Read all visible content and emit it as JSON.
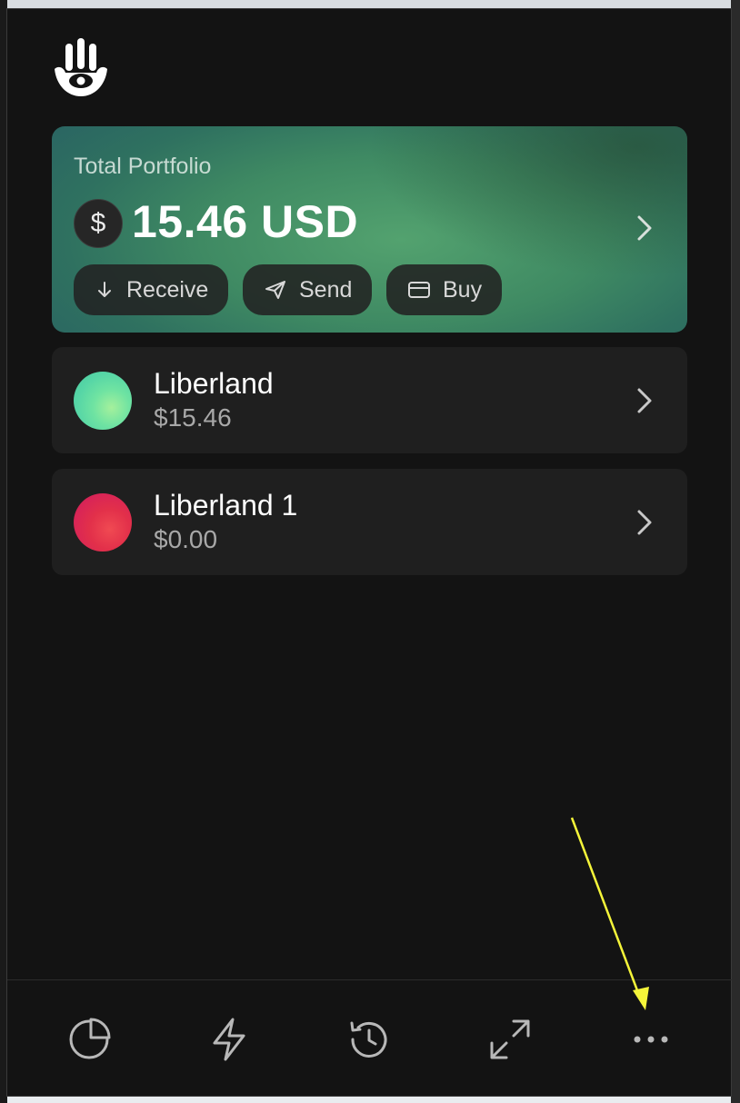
{
  "portfolio": {
    "label": "Total Portfolio",
    "currency_symbol": "$",
    "amount": "15.46 USD"
  },
  "actions": {
    "receive_label": "Receive",
    "send_label": "Send",
    "buy_label": "Buy"
  },
  "accounts": [
    {
      "name": "Liberland",
      "balance": "$15.46",
      "avatar_color": "#6fe3a2"
    },
    {
      "name": "Liberland 1",
      "balance": "$0.00",
      "avatar_color": "#e2304a"
    }
  ],
  "bottom_nav": {
    "items": [
      {
        "icon": "pie-chart-icon"
      },
      {
        "icon": "lightning-icon"
      },
      {
        "icon": "history-icon"
      },
      {
        "icon": "expand-icon"
      },
      {
        "icon": "more-dots-icon"
      }
    ]
  },
  "colors": {
    "background": "#131313",
    "card": "#1f1f1f",
    "annotation_arrow": "#f5f53a"
  }
}
